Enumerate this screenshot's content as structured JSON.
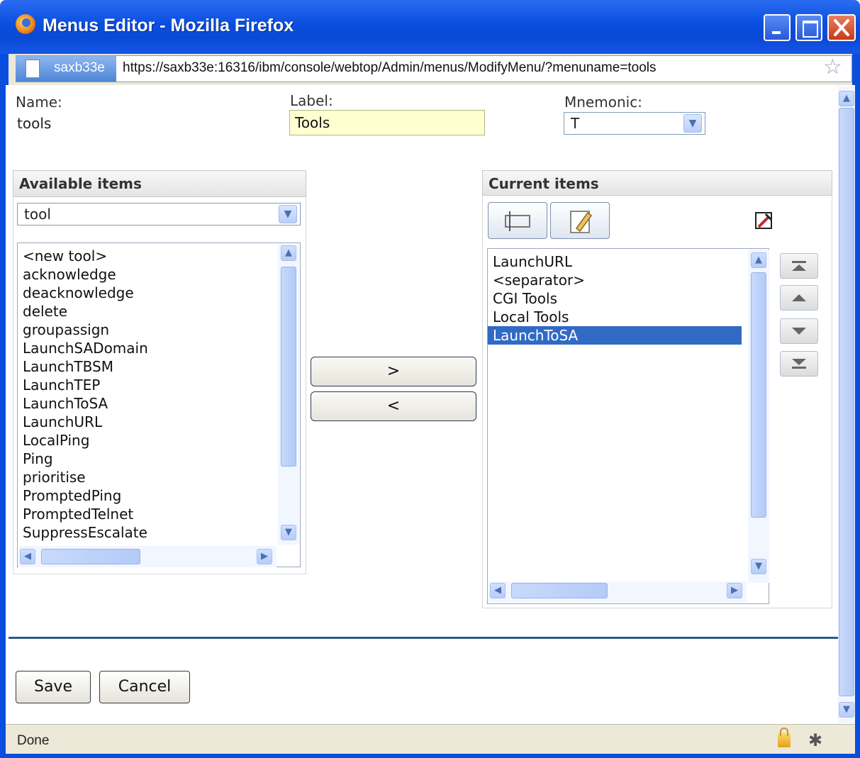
{
  "window": {
    "title": "Menus Editor - Mozilla Firefox"
  },
  "address_bar": {
    "site_name": "saxb33e",
    "url": "https://saxb33e:16316/ibm/console/webtop/Admin/menus/ModifyMenu/?menuname=tools"
  },
  "form": {
    "name_label": "Name:",
    "name_value": "tools",
    "label_label": "Label:",
    "label_value": "Tools",
    "mnemonic_label": "Mnemonic:",
    "mnemonic_value": "T"
  },
  "available": {
    "heading": "Available items",
    "filter_value": "tool",
    "items": [
      "<new tool>",
      "acknowledge",
      "deacknowledge",
      "delete",
      "groupassign",
      "LaunchSADomain",
      "LaunchTBSM",
      "LaunchTEP",
      "LaunchToSA",
      "LaunchURL",
      "LocalPing",
      "Ping",
      "prioritise",
      "PromptedPing",
      "PromptedTelnet",
      "SuppressEscalate"
    ]
  },
  "move_buttons": {
    "add_label": ">",
    "remove_label": "<"
  },
  "current": {
    "heading": "Current items",
    "items": [
      "LaunchURL",
      "<separator>",
      "CGI Tools",
      "Local Tools",
      "LaunchToSA"
    ],
    "selected_index": 4,
    "selection_color": "#316ac5"
  },
  "actions": {
    "save_label": "Save",
    "cancel_label": "Cancel"
  },
  "status": {
    "text": "Done"
  }
}
